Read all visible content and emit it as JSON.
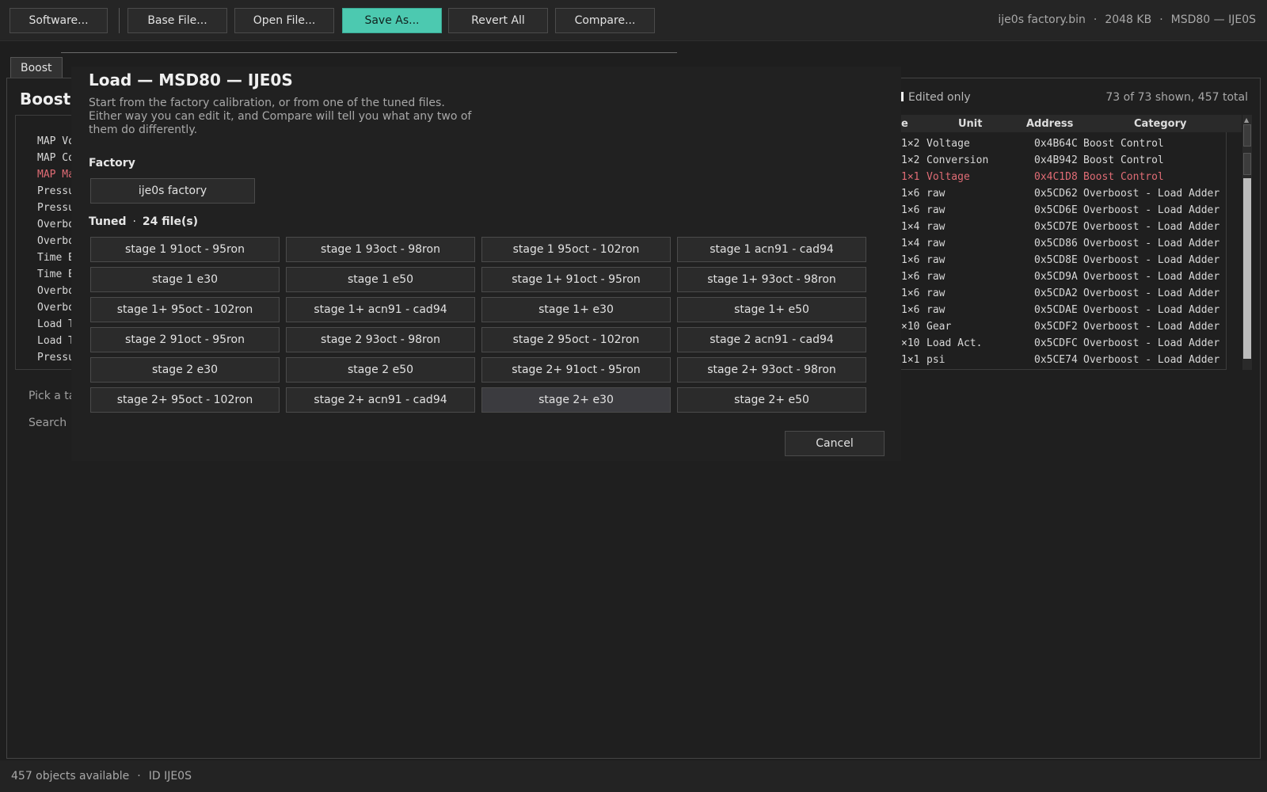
{
  "toolbar": {
    "software": "Software...",
    "base_file": "Base File...",
    "open_file": "Open File...",
    "save_as": "Save As...",
    "revert_all": "Revert All",
    "compare": "Compare...",
    "file_name": "ije0s factory.bin",
    "file_size": "2048 KB",
    "ecu_id": "MSD80 — IJE0S",
    "accent_color": "#4cc9b0"
  },
  "tabs": {
    "active": "Boost"
  },
  "main": {
    "title": "Boost",
    "list_rows": [
      {
        "label": "MAP Vo",
        "edited": false
      },
      {
        "label": "MAP Co",
        "edited": false
      },
      {
        "label": "MAP Ma",
        "edited": true
      },
      {
        "label": "Pressu",
        "edited": false
      },
      {
        "label": "Pressu",
        "edited": false
      },
      {
        "label": "Overbo",
        "edited": false
      },
      {
        "label": "Overbo",
        "edited": false
      },
      {
        "label": "Time B",
        "edited": false
      },
      {
        "label": "Time B",
        "edited": false
      },
      {
        "label": "Overbo",
        "edited": false
      },
      {
        "label": "Overbo",
        "edited": false
      },
      {
        "label": "Load T",
        "edited": false
      },
      {
        "label": "Load T",
        "edited": false
      },
      {
        "label": "Pressu",
        "edited": false
      }
    ],
    "pick_text": "Pick a ta",
    "search_text": "Search",
    "edited_only_label": "Edited only",
    "shown_count": "73 of 73 shown, 457 total",
    "table": {
      "columns": {
        "size": "e",
        "unit": "Unit",
        "address": "Address",
        "category": "Category"
      },
      "rows": [
        {
          "size": "1×2",
          "unit": "Voltage",
          "address": "0x4B64C",
          "category": "Boost Control",
          "edited": false
        },
        {
          "size": "1×2",
          "unit": "Conversion",
          "address": "0x4B942",
          "category": "Boost Control",
          "edited": false
        },
        {
          "size": "1×1",
          "unit": "Voltage",
          "address": "0x4C1D8",
          "category": "Boost Control",
          "edited": true
        },
        {
          "size": "1×6",
          "unit": "raw",
          "address": "0x5CD62",
          "category": "Overboost - Load Adder",
          "edited": false
        },
        {
          "size": "1×6",
          "unit": "raw",
          "address": "0x5CD6E",
          "category": "Overboost - Load Adder",
          "edited": false
        },
        {
          "size": "1×4",
          "unit": "raw",
          "address": "0x5CD7E",
          "category": "Overboost - Load Adder",
          "edited": false
        },
        {
          "size": "1×4",
          "unit": "raw",
          "address": "0x5CD86",
          "category": "Overboost - Load Adder",
          "edited": false
        },
        {
          "size": "1×6",
          "unit": "raw",
          "address": "0x5CD8E",
          "category": "Overboost - Load Adder",
          "edited": false
        },
        {
          "size": "1×6",
          "unit": "raw",
          "address": "0x5CD9A",
          "category": "Overboost - Load Adder",
          "edited": false
        },
        {
          "size": "1×6",
          "unit": "raw",
          "address": "0x5CDA2",
          "category": "Overboost - Load Adder",
          "edited": false
        },
        {
          "size": "1×6",
          "unit": "raw",
          "address": "0x5CDAE",
          "category": "Overboost - Load Adder",
          "edited": false
        },
        {
          "size": "×10",
          "unit": "Gear",
          "address": "0x5CDF2",
          "category": "Overboost - Load Adder",
          "edited": false
        },
        {
          "size": "×10",
          "unit": "Load Act.",
          "address": "0x5CDFC",
          "category": "Overboost - Load Adder",
          "edited": false
        },
        {
          "size": "1×1",
          "unit": "psi",
          "address": "0x5CE74",
          "category": "Overboost - Load Adder",
          "edited": false
        }
      ]
    }
  },
  "modal": {
    "title": "Load — MSD80 — IJE0S",
    "description": "Start from the factory calibration, or from one of the tuned files. Either way you can edit it, and Compare will tell you what any two of them do differently.",
    "factory_label": "Factory",
    "factory_file": "ije0s factory",
    "tuned_label": "Tuned",
    "tuned_count": "24 file(s)",
    "tuned_files": [
      "stage 1 91oct - 95ron",
      "stage 1 93oct - 98ron",
      "stage 1 95oct - 102ron",
      "stage 1 acn91 - cad94",
      "stage 1 e30",
      "stage 1 e50",
      "stage 1+ 91oct - 95ron",
      "stage 1+ 93oct - 98ron",
      "stage 1+ 95oct - 102ron",
      "stage 1+ acn91 - cad94",
      "stage 1+ e30",
      "stage 1+ e50",
      "stage 2 91oct - 95ron",
      "stage 2 93oct - 98ron",
      "stage 2 95oct - 102ron",
      "stage 2 acn91 - cad94",
      "stage 2 e30",
      "stage 2 e50",
      "stage 2+ 91oct - 95ron",
      "stage 2+ 93oct - 98ron",
      "stage 2+ 95oct - 102ron",
      "stage 2+ acn91 - cad94",
      "stage 2+ e30",
      "stage 2+ e50"
    ],
    "hovered_index": 22,
    "cancel": "Cancel"
  },
  "status": {
    "objects": "457 objects available",
    "id": "ID IJE0S"
  }
}
